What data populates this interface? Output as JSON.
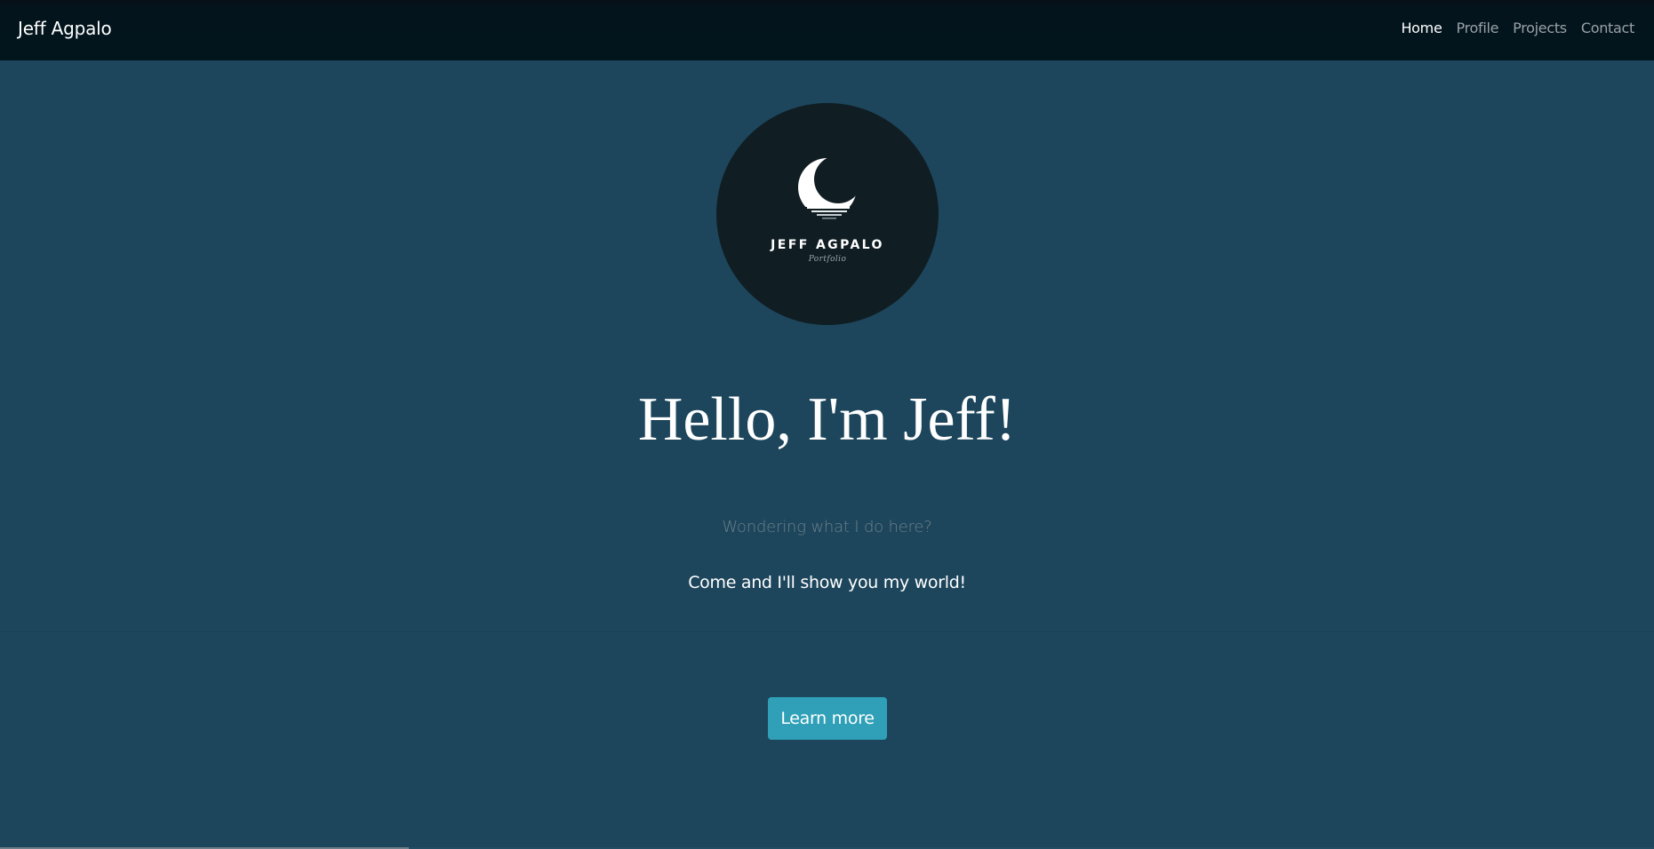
{
  "navbar": {
    "brand": "Jeff Agpalo",
    "links": [
      {
        "label": "Home"
      },
      {
        "label": "Profile"
      },
      {
        "label": "Projects"
      },
      {
        "label": "Contact"
      }
    ]
  },
  "logo": {
    "name": "JEFF AGPALO",
    "subtitle": "Portfolio",
    "icon": "crescent-moon-icon"
  },
  "hero": {
    "title": "Hello, I'm Jeff!",
    "subtitle": "Wondering what I do here?",
    "text": "Come and I'll show you my world!",
    "button_label": "Learn more"
  },
  "colors": {
    "background": "#1d465c",
    "navbar": "#02141c",
    "logo_circle": "#101e23",
    "button": "#2fa0b8",
    "nav_active": "#ffffff",
    "nav_inactive": "#9aa1a6"
  }
}
